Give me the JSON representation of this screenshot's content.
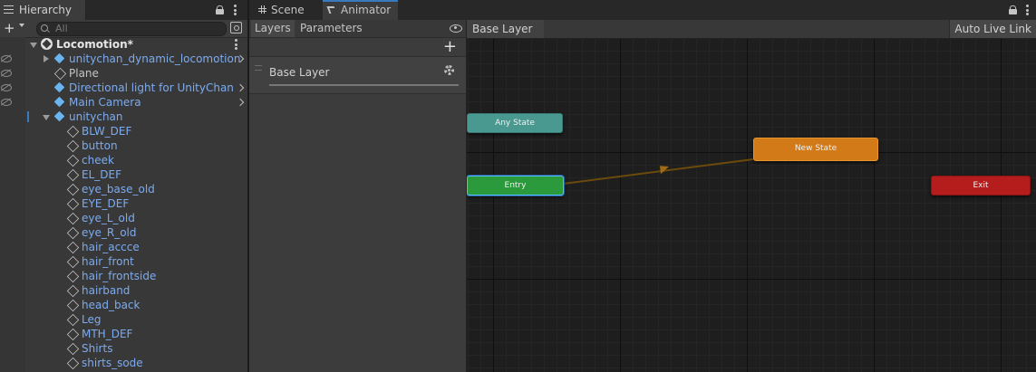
{
  "hierarchy": {
    "tab_label": "Hierarchy",
    "add_label": "+",
    "search_placeholder": "All",
    "scene": {
      "name": "Locomotion*"
    },
    "items": [
      {
        "label": "unitychan_dynamic_locomotion",
        "color": "blue",
        "icon": "prefab-cube-icon",
        "expand": "collapsed",
        "chevron": true,
        "hidden": true
      },
      {
        "label": "Plane",
        "color": "plain",
        "icon": "cube-outline-icon",
        "expand": "none",
        "chevron": false,
        "hidden": true
      },
      {
        "label": "Directional light for UnityChan",
        "color": "blue",
        "icon": "prefab-cube-icon",
        "expand": "none",
        "chevron": true,
        "hidden": true
      },
      {
        "label": "Main Camera",
        "color": "blue",
        "icon": "prefab-cube-icon",
        "expand": "none",
        "chevron": true,
        "hidden": true
      },
      {
        "label": "unitychan",
        "color": "blue",
        "icon": "prefab-cube-icon",
        "expand": "expanded",
        "chevron": false,
        "hidden": false,
        "selected": true
      }
    ],
    "children": [
      "BLW_DEF",
      "button",
      "cheek",
      "EL_DEF",
      "eye_base_old",
      "EYE_DEF",
      "eye_L_old",
      "eye_R_old",
      "hair_accce",
      "hair_front",
      "hair_frontside",
      "hairband",
      "head_back",
      "Leg",
      "MTH_DEF",
      "Shirts",
      "shirts_sode"
    ]
  },
  "animator": {
    "tabs": [
      {
        "label": "Scene",
        "icon": "grid-icon",
        "active": false
      },
      {
        "label": "Animator",
        "icon": "animator-icon",
        "active": true
      }
    ],
    "subtabs": {
      "layers": "Layers",
      "parameters": "Parameters"
    },
    "add_label": "+",
    "layer": {
      "name": "Base Layer"
    },
    "breadcrumb": "Base Layer",
    "auto_live_link": "Auto Live Link",
    "states": {
      "any": "Any State",
      "entry": "Entry",
      "new_state": "New State",
      "exit": "Exit"
    },
    "colors": {
      "any_state": "#4a9990",
      "entry": "#2a9a3c",
      "default_state": "#d27a18",
      "exit": "#b51d1d",
      "transition": "#6b4a0c"
    }
  }
}
